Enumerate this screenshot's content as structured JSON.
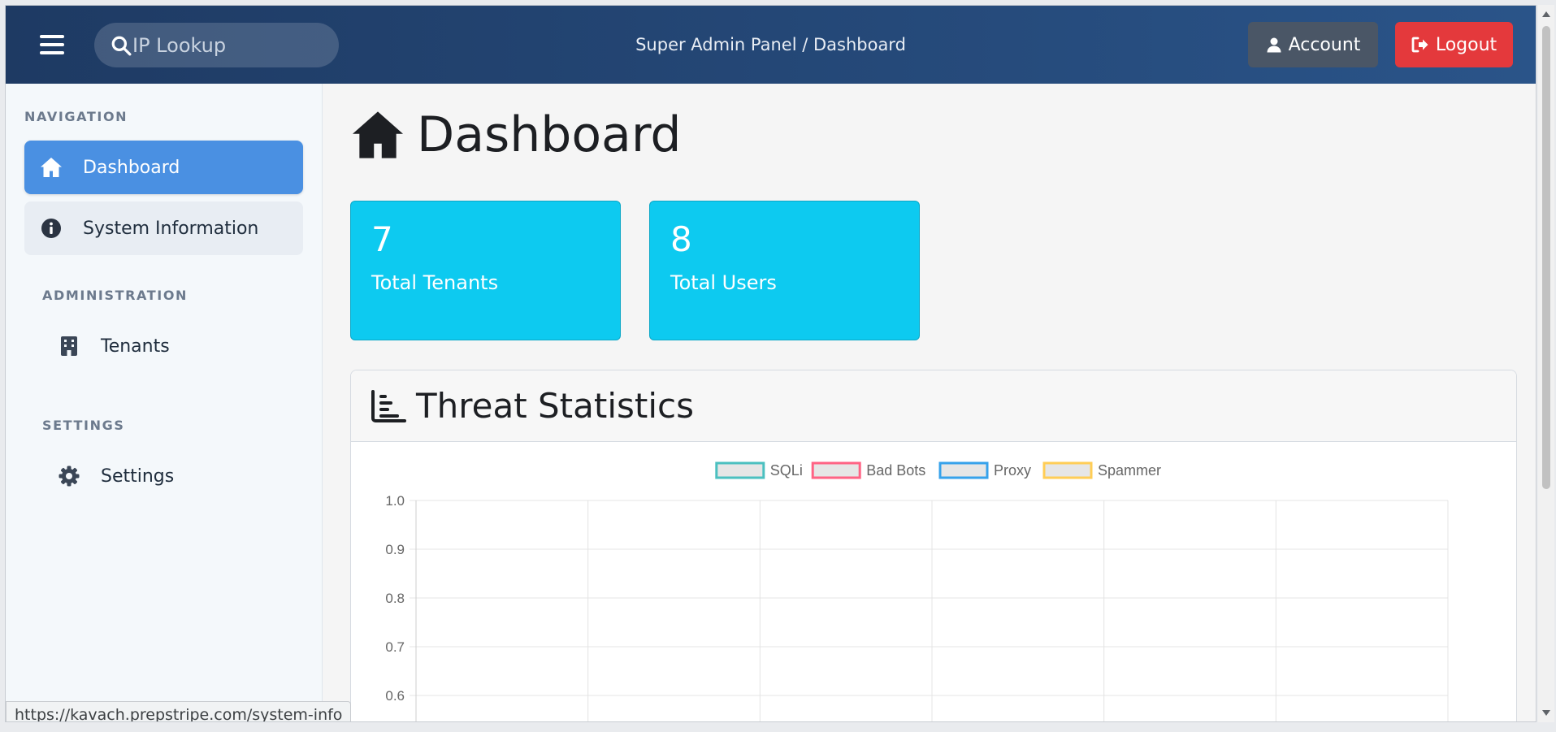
{
  "topbar": {
    "search_placeholder": "IP Lookup",
    "breadcrumb": "Super Admin Panel / Dashboard",
    "account_label": "Account",
    "logout_label": "Logout"
  },
  "sidebar": {
    "sections": [
      {
        "title": "NAVIGATION"
      },
      {
        "title": "ADMINISTRATION"
      },
      {
        "title": "SETTINGS"
      }
    ],
    "items": [
      {
        "label": "Dashboard",
        "icon": "home-icon",
        "active": true
      },
      {
        "label": "System Information",
        "icon": "info-circle-icon"
      },
      {
        "label": "Tenants",
        "icon": "building-icon"
      },
      {
        "label": "Settings",
        "icon": "gear-icon"
      }
    ]
  },
  "main": {
    "title": "Dashboard",
    "stats": [
      {
        "value": "7",
        "label": "Total Tenants"
      },
      {
        "value": "8",
        "label": "Total Users"
      }
    ],
    "panel_title": "Threat Statistics"
  },
  "chart_data": {
    "type": "line",
    "title": "",
    "xlabel": "",
    "ylabel": "",
    "ylim": [
      0.6,
      1.0
    ],
    "y_ticks": [
      "1.0",
      "0.9",
      "0.8",
      "0.7",
      "0.6"
    ],
    "grid": true,
    "legend_position": "top-center",
    "series": [
      {
        "name": "SQLi",
        "color": "#4bc0c0",
        "values": []
      },
      {
        "name": "Bad Bots",
        "color": "#ff6384",
        "values": []
      },
      {
        "name": "Proxy",
        "color": "#36a2eb",
        "values": []
      },
      {
        "name": "Spammer",
        "color": "#ffcd56",
        "values": []
      }
    ]
  },
  "status_bar": {
    "url": "https://kavach.prepstripe.com/system-info"
  },
  "colors": {
    "header_start": "#1e3a63",
    "header_end": "#2a5489",
    "active_nav": "#4a90e2",
    "stat_card": "#0dcaf0",
    "logout": "#e4393c",
    "account": "#4a5666"
  }
}
